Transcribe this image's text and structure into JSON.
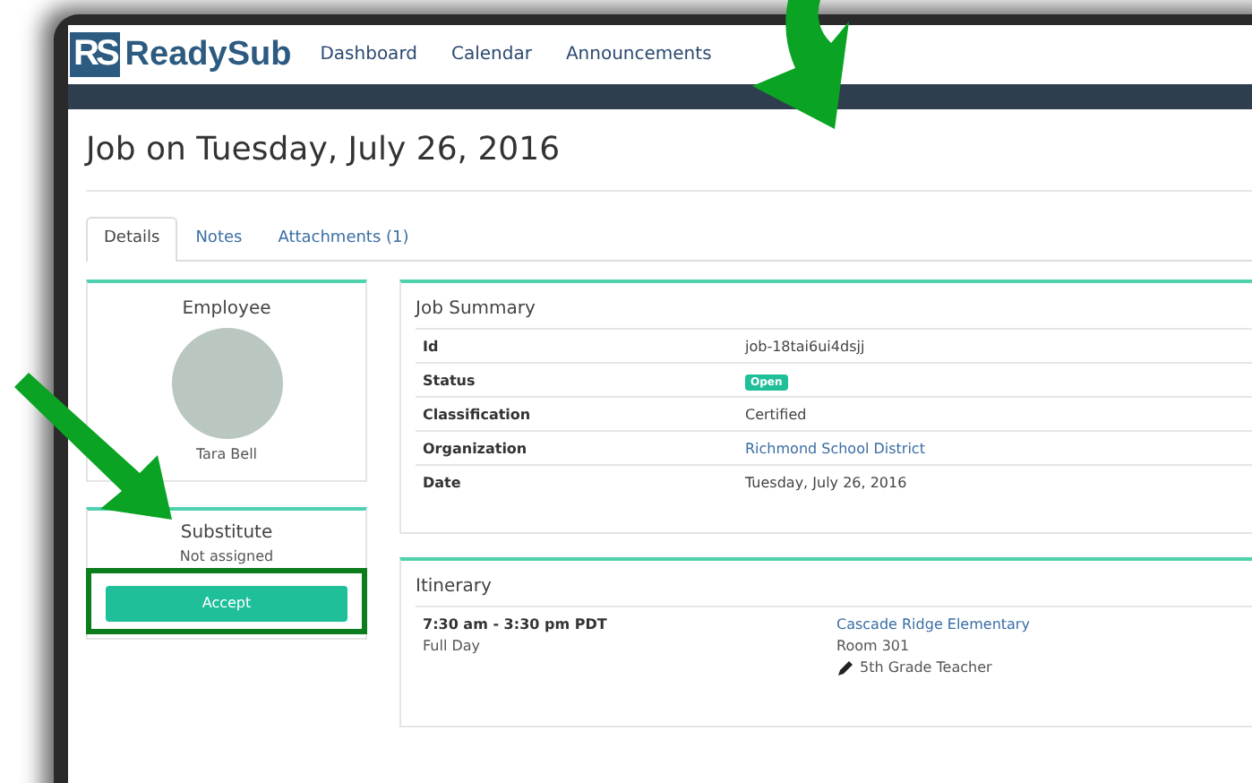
{
  "navbar": {
    "logo_mark": "RS",
    "logo_text": "ReadySub",
    "links": [
      {
        "label": "Dashboard"
      },
      {
        "label": "Calendar"
      },
      {
        "label": "Announcements"
      }
    ]
  },
  "page_title": "Job on Tuesday, July 26, 2016",
  "tabs": [
    {
      "label": "Details",
      "selected": true
    },
    {
      "label": "Notes",
      "selected": false
    },
    {
      "label": "Attachments (1)",
      "selected": false
    }
  ],
  "employee": {
    "heading": "Employee",
    "name": "Tara Bell"
  },
  "substitute": {
    "heading": "Substitute",
    "status": "Not assigned",
    "button": "Accept"
  },
  "job_summary": {
    "heading": "Job Summary",
    "rows": [
      {
        "label": "Id",
        "value": "job-18tai6ui4dsjj",
        "kind": "text"
      },
      {
        "label": "Status",
        "value": "Open",
        "kind": "badge"
      },
      {
        "label": "Classification",
        "value": "Certified",
        "kind": "text"
      },
      {
        "label": "Organization",
        "value": "Richmond School District",
        "kind": "link"
      },
      {
        "label": "Date",
        "value": "Tuesday, July 26, 2016",
        "kind": "text"
      }
    ]
  },
  "itinerary": {
    "heading": "Itinerary",
    "time": "7:30 am - 3:30 pm PDT",
    "duration": "Full Day",
    "location": "Cascade Ridge Elementary",
    "room": "Room 301",
    "position": "5th Grade Teacher"
  }
}
